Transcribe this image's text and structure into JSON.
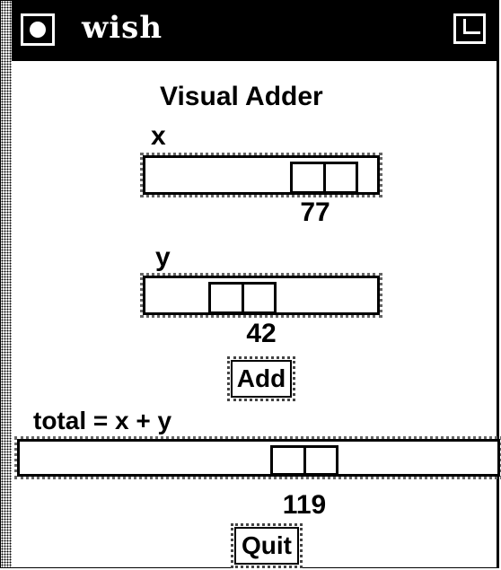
{
  "window": {
    "title": "wish"
  },
  "app": {
    "heading": "Visual Adder"
  },
  "x": {
    "label": "x",
    "value": "77",
    "level": 0.77
  },
  "y": {
    "label": "y",
    "value": "42",
    "level": 0.42
  },
  "total": {
    "label": "total = x + y",
    "value": "119",
    "level": 0.595
  },
  "buttons": {
    "add": "Add",
    "quit": "Quit"
  }
}
